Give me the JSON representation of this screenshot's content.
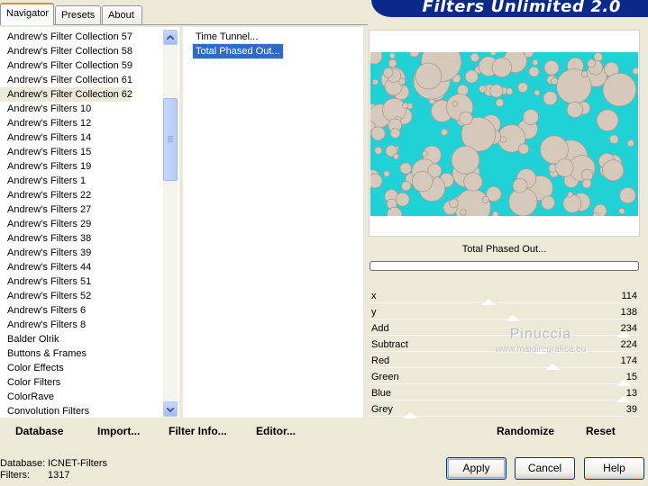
{
  "tabs": [
    {
      "label": "Navigator",
      "active": true
    },
    {
      "label": "Presets",
      "active": false
    },
    {
      "label": "About",
      "active": false
    }
  ],
  "header": {
    "title": "Filters Unlimited 2.0"
  },
  "categories": [
    "Andrew's Filter Collection 57",
    "Andrew's Filter Collection 58",
    "Andrew's Filter Collection 59",
    "Andrew's Filter Collection 61",
    "Andrew's Filter Collection 62",
    "Andrew's Filters 10",
    "Andrew's Filters 12",
    "Andrew's Filters 14",
    "Andrew's Filters 15",
    "Andrew's Filters 19",
    "Andrew's Filters 1",
    "Andrew's Filters 22",
    "Andrew's Filters 27",
    "Andrew's Filters 29",
    "Andrew's Filters 38",
    "Andrew's Filters 39",
    "Andrew's Filters 44",
    "Andrew's Filters 51",
    "Andrew's Filters 52",
    "Andrew's Filters 6",
    "Andrew's Filters 8",
    "Balder Olrik",
    "Buttons & Frames",
    "Color Effects",
    "Color Filters",
    "ColorRave",
    "Convolution Filters"
  ],
  "selected_category": "Andrew's Filter Collection 62",
  "filters": [
    "Time Tunnel...",
    "Total Phased Out..."
  ],
  "selected_filter": "Total Phased Out...",
  "preview": {
    "filter_name": "Total Phased Out...",
    "progress": 0,
    "bg_color": "#1ed2d6",
    "blob_color": "#d6c9bc"
  },
  "params": [
    {
      "label": "x",
      "value": "114"
    },
    {
      "label": "y",
      "value": "138"
    },
    {
      "label": "Add",
      "value": "234"
    },
    {
      "label": "Subtract",
      "value": "224"
    },
    {
      "label": "Red",
      "value": "174"
    },
    {
      "label": "Green",
      "value": "15"
    },
    {
      "label": "Blue",
      "value": "13"
    },
    {
      "label": "Grey",
      "value": "39"
    }
  ],
  "watermark": {
    "line1": "Pinuccia",
    "line2": "www.maidiregrafica.eu"
  },
  "links": {
    "database": "Database",
    "import": "Import...",
    "filter_info": "Filter Info...",
    "editor": "Editor...",
    "randomize": "Randomize",
    "reset": "Reset"
  },
  "status": {
    "database_label": "Database:",
    "database_value": "ICNET-Filters",
    "filters_label": "Filters:",
    "filters_value": "1317"
  },
  "buttons": {
    "apply": "Apply",
    "cancel": "Cancel",
    "help": "Help"
  },
  "colors": {
    "selection": "#316ac5",
    "header": "#0a2a8a",
    "dialog_bg": "#ece9d8"
  }
}
